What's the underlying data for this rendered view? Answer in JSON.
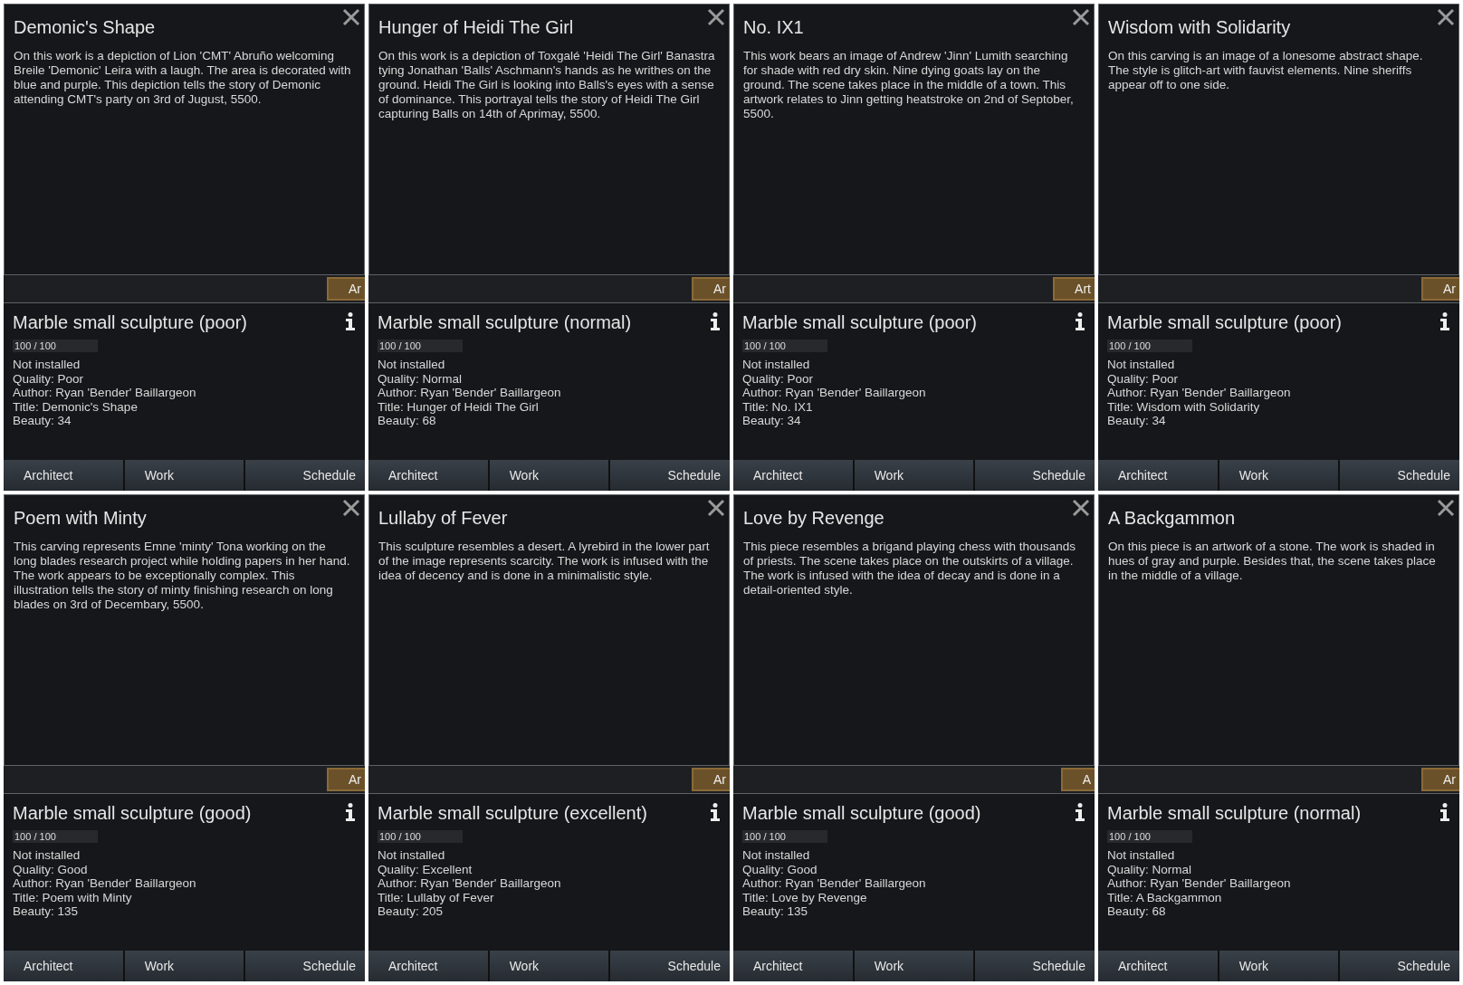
{
  "panels": [
    {
      "title": "Demonic's Shape",
      "description": "On this work is a depiction of Lion 'CMT' Abruño welcoming Breile 'Demonic' Leira with a laugh. The area is decorated with blue and purple. This depiction tells the story of Demonic attending CMT's party on 3rd of Jugust, 5500.",
      "cut_button": "Ar",
      "item_name": "Marble small sculpture (poor)",
      "hit_points": "100 / 100",
      "lines": [
        "Not installed",
        "Quality: Poor",
        "Author: Ryan 'Bender' Baillargeon",
        "Title: Demonic's Shape",
        "Beauty: 34"
      ],
      "tabs": [
        "Architect",
        "Work",
        "Schedule"
      ]
    },
    {
      "title": "Hunger of Heidi The Girl",
      "description": "On this work is a depiction of Toxgalé 'Heidi The Girl' Banastra tying Jonathan 'Balls' Aschmann's hands as he writhes on the ground. Heidi The Girl is looking into Balls's eyes with a sense of dominance. This portrayal tells the story of Heidi The Girl capturing Balls on 14th of Aprimay, 5500.",
      "cut_button": "Ar",
      "item_name": "Marble small sculpture (normal)",
      "hit_points": "100 / 100",
      "lines": [
        "Not installed",
        "Quality: Normal",
        "Author: Ryan 'Bender' Baillargeon",
        "Title: Hunger of Heidi The Girl",
        "Beauty: 68"
      ],
      "tabs": [
        "Architect",
        "Work",
        "Schedule"
      ]
    },
    {
      "title": "No. IX1",
      "description": "This work bears an image of Andrew 'Jinn' Lumith searching for shade with red dry skin. Nine dying goats lay on the ground. The scene takes place in the middle of a town. This artwork relates to Jinn getting heatstroke on 2nd of Septober, 5500.",
      "cut_button": "Art",
      "item_name": "Marble small sculpture (poor)",
      "hit_points": "100 / 100",
      "lines": [
        "Not installed",
        "Quality: Poor",
        "Author: Ryan 'Bender' Baillargeon",
        "Title: No. IX1",
        "Beauty: 34"
      ],
      "tabs": [
        "Architect",
        "Work",
        "Schedule"
      ]
    },
    {
      "title": "Wisdom with Solidarity",
      "description": "On this carving is an image of a lonesome abstract shape. The style is glitch-art with fauvist elements. Nine sheriffs appear off to one side.",
      "cut_button": "Ar",
      "item_name": "Marble small sculpture (poor)",
      "hit_points": "100 / 100",
      "lines": [
        "Not installed",
        "Quality: Poor",
        "Author: Ryan 'Bender' Baillargeon",
        "Title: Wisdom with Solidarity",
        "Beauty: 34"
      ],
      "tabs": [
        "Architect",
        "Work",
        "Schedule"
      ]
    },
    {
      "title": "Poem with Minty",
      "description": "This carving represents Emne 'minty' Tona working on the long blades research project while holding papers in her hand. The work appears to be exceptionally complex. This illustration tells the story of minty finishing research on long blades on 3rd of Decembary, 5500.",
      "cut_button": "Ar",
      "item_name": "Marble small sculpture (good)",
      "hit_points": "100 / 100",
      "lines": [
        "Not installed",
        "Quality: Good",
        "Author: Ryan 'Bender' Baillargeon",
        "Title: Poem with Minty",
        "Beauty: 135"
      ],
      "tabs": [
        "Architect",
        "Work",
        "Schedule"
      ]
    },
    {
      "title": "Lullaby of Fever",
      "description": "This sculpture resembles a desert. A lyrebird in the lower part of the image represents scarcity. The work is infused with the idea of decency and is done in a minimalistic style.",
      "cut_button": "Ar",
      "item_name": "Marble small sculpture (excellent)",
      "hit_points": "100 / 100",
      "lines": [
        "Not installed",
        "Quality: Excellent",
        "Author: Ryan 'Bender' Baillargeon",
        "Title: Lullaby of Fever",
        "Beauty: 205"
      ],
      "tabs": [
        "Architect",
        "Work",
        "Schedule"
      ]
    },
    {
      "title": "Love by Revenge",
      "description": "This piece resembles a brigand playing chess with thousands of priests. The scene takes place on the outskirts of a village. The work is infused with the idea of decay and is done in a detail-oriented style.",
      "cut_button": "A",
      "item_name": "Marble small sculpture (good)",
      "hit_points": "100 / 100",
      "lines": [
        "Not installed",
        "Quality: Good",
        "Author: Ryan 'Bender' Baillargeon",
        "Title: Love by Revenge",
        "Beauty: 135"
      ],
      "tabs": [
        "Architect",
        "Work",
        "Schedule"
      ]
    },
    {
      "title": "A Backgammon",
      "description": "On this piece is an artwork of a stone. The work is shaded in hues of gray and purple. Besides that, the scene takes place in the middle of a village.",
      "cut_button": "Ar",
      "item_name": "Marble small sculpture (normal)",
      "hit_points": "100 / 100",
      "lines": [
        "Not installed",
        "Quality: Normal",
        "Author: Ryan 'Bender' Baillargeon",
        "Title: A Backgammon",
        "Beauty: 68"
      ],
      "tabs": [
        "Architect",
        "Work",
        "Schedule"
      ]
    }
  ]
}
